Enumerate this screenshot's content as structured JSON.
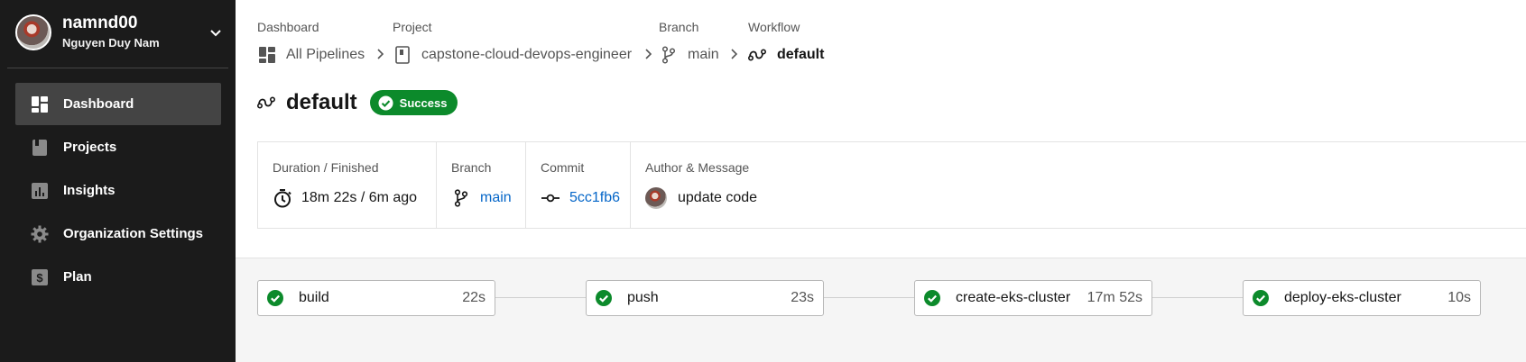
{
  "user": {
    "username": "namnd00",
    "fullname": "Nguyen Duy Nam"
  },
  "nav": {
    "items": [
      {
        "label": "Dashboard",
        "icon": "dashboard-icon",
        "active": true
      },
      {
        "label": "Projects",
        "icon": "book-icon"
      },
      {
        "label": "Insights",
        "icon": "bar-chart-icon"
      },
      {
        "label": "Organization Settings",
        "icon": "gear-icon"
      },
      {
        "label": "Plan",
        "icon": "dollar-icon"
      }
    ]
  },
  "breadcrumb": {
    "dashboard": {
      "label": "Dashboard",
      "value": "All Pipelines"
    },
    "project": {
      "label": "Project",
      "value": "capstone-cloud-devops-engineer"
    },
    "branch": {
      "label": "Branch",
      "value": "main"
    },
    "workflow": {
      "label": "Workflow",
      "value": "default"
    }
  },
  "workflow": {
    "title": "default",
    "status": "Success",
    "status_color": "#0c8a2b"
  },
  "summary": {
    "duration": {
      "label": "Duration / Finished",
      "value": "18m 22s / 6m ago"
    },
    "branch": {
      "label": "Branch",
      "value": "main"
    },
    "commit": {
      "label": "Commit",
      "value": "5cc1fb6"
    },
    "author": {
      "label": "Author & Message",
      "value": "update code"
    }
  },
  "jobs": [
    {
      "name": "build",
      "duration": "22s",
      "status": "success"
    },
    {
      "name": "push",
      "duration": "23s",
      "status": "success"
    },
    {
      "name": "create-eks-cluster",
      "duration": "17m 52s",
      "status": "success"
    },
    {
      "name": "deploy-eks-cluster",
      "duration": "10s",
      "status": "success"
    }
  ],
  "colors": {
    "sidebar_bg": "#1b1b1b",
    "link": "#0566c8",
    "success": "#0c8a2b"
  }
}
